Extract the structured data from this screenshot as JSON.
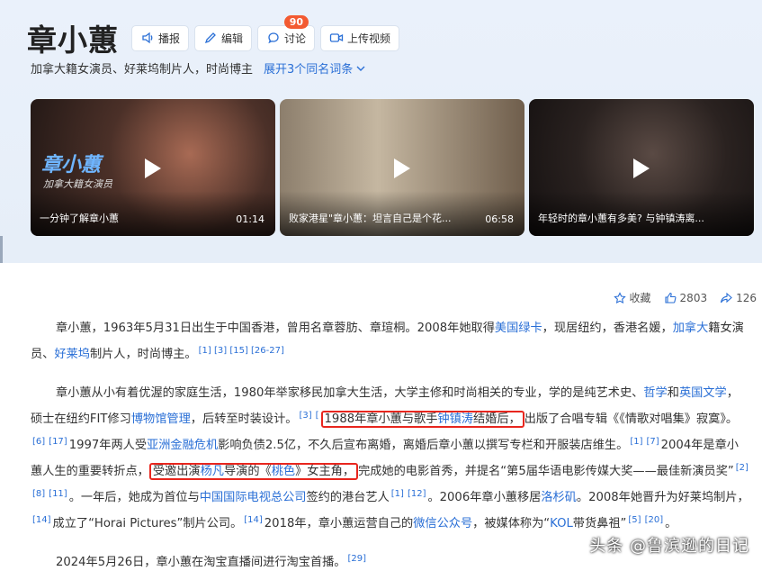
{
  "entry": {
    "title": "章小蕙",
    "subtitle": "加拿大籍女演员、好莱坞制片人，时尚博主",
    "expand_label": "展开3个同名词条"
  },
  "toolbar": {
    "report_label": "播报",
    "edit_label": "编辑",
    "discuss_label": "讨论",
    "discuss_badge": "90",
    "upload_label": "上传视频"
  },
  "videos": [
    {
      "title": "一分钟了解章小蕙",
      "duration": "01:14",
      "overlay_name": "章小蕙",
      "overlay_sub": "加拿大籍女演员"
    },
    {
      "title": "败家港星\"章小蕙：坦言自己是个花...",
      "duration": "06:58"
    },
    {
      "title": "年轻时的章小蕙有多美? 与钟镇涛离...",
      "duration": ""
    }
  ],
  "actions": {
    "favorite_label": "收藏",
    "like_count": "2803",
    "share_count": "126"
  },
  "article": {
    "p1": {
      "t1": "章小蕙，1963年5月31日出生于中国香港，曾用名章蓉肪、章瑄桐。2008年她取得",
      "l1": "美国绿卡",
      "t2": "，现居纽约，香港名媛，",
      "l2": "加拿大",
      "t3": "籍女演员、",
      "l3": "好莱坞",
      "t4": "制片人，时尚博主。",
      "refs": "[1] [3] [15] [26-27]"
    },
    "p2": {
      "t1": "章小蕙从小有着优渥的家庭生活，1980年举家移民加拿大生活，大学主修和时尚相关的专业，学的是纯艺术史、",
      "l1": "哲学",
      "t2": "和",
      "l2": "英国文学",
      "t3": "，硕士在纽约FIT修习",
      "l3": "博物馆管理",
      "t4": "，后转至时装设计。",
      "r1": "[3]",
      "r2": "[",
      "h1a": "1988年章小蕙与歌手",
      "h1l": "钟镇涛",
      "h1b": "结婚后，",
      "t5": "出版了合唱专辑《《情歌对唱集》寂寞》。",
      "r3": "[6]",
      "r4": "[17]",
      "t6": "1997年两人受",
      "l4": "亚洲金融危机",
      "t7": "影响负债2.5亿，不久后宣布离婚，离婚后章小蕙以撰写专栏和开服装店维生。",
      "r5": "[1]",
      "r6": "[7]",
      "t8": "2004年是章小蕙人生的重要转折点，",
      "h2a": "受邀出演",
      "h2l1": "杨凡",
      "h2b": "导演的《",
      "h2l2": "桃色",
      "h2c": "》女主角，",
      "t9": "完成她的电影首秀，并提名“第5届华语电影传媒大奖——最佳新演员奖”",
      "r7": "[2]",
      "r8": "[8]",
      "r9": "[11]",
      "t10": "。一年后，她成为首位与",
      "l5": "中国国际电视总公司",
      "t11": "签约的港台艺人",
      "r10": "[1]",
      "r11": "[12]",
      "t12": "。2006年章小蕙移居",
      "l6": "洛杉矶",
      "t13": "。2008年她晋升为好莱坞制片，",
      "r12": "[14]",
      "t14": "成立了“Horai Pictures”制片公司。",
      "r13": "[14]",
      "t15": "2018年，章小蕙运营自己的",
      "l7": "微信公众号",
      "t16": "，被媒体称为“",
      "l8": "KOL",
      "t17": "带货鼻祖”",
      "r14": "[5]",
      "r15": "[20]",
      "t18": "。"
    },
    "p3": {
      "t1": "2024年5月26日，章小蕙在淘宝直播间进行淘宝首播。",
      "r1": "[29]"
    }
  },
  "watermark": "头条 @鲁滨逊的日记",
  "colors": {
    "link": "#2a6fd6",
    "highlight_box": "#e8261e",
    "badge": "#f35a31",
    "header_bg": "#eaf1fb"
  }
}
